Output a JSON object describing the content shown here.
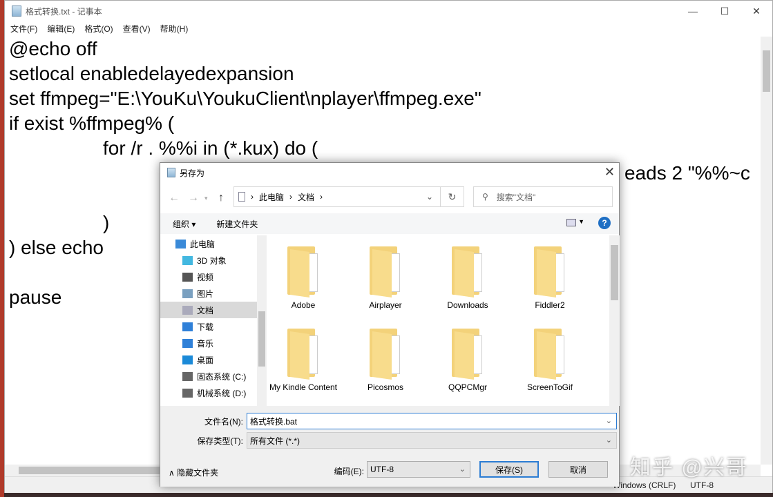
{
  "notepad": {
    "title": "格式转换.txt - 记事本",
    "window_buttons": [
      "—",
      "☐",
      "✕"
    ],
    "menu": [
      "文件(F)",
      "编辑(E)",
      "格式(O)",
      "查看(V)",
      "帮助(H)"
    ],
    "lines": [
      "@echo off",
      "setlocal enabledelayedexpansion",
      "set ffmpeg=\"E:\\YouKu\\YoukuClient\\nplayer\\ffmpeg.exe\"",
      "if exist %ffmpeg% (",
      "for /r . %%i in (*.kux) do (",
      "",
      "",
      ")",
      ") else echo",
      "",
      "pause"
    ],
    "partial_line": "eads 2 \"%%~c",
    "status": {
      "line_ending": "Windows (CRLF)",
      "encoding": "UTF-8"
    }
  },
  "watermark": "知乎 @兴哥",
  "dialog": {
    "title": "另存为",
    "close": "✕",
    "breadcrumb": [
      "此电脑",
      "文档"
    ],
    "search_placeholder": "搜索\"文档\"",
    "toolbar": {
      "organize": "组织 ▾",
      "new_folder": "新建文件夹",
      "help": "?"
    },
    "nav_items": [
      {
        "label": "此电脑",
        "icon": "computer-icon",
        "color": "#3a8ad8",
        "top": true
      },
      {
        "label": "3D 对象",
        "icon": "cube-icon",
        "color": "#43b8e0"
      },
      {
        "label": "视频",
        "icon": "film-icon",
        "color": "#555"
      },
      {
        "label": "图片",
        "icon": "picture-icon",
        "color": "#7aa0c0"
      },
      {
        "label": "文档",
        "icon": "document-icon",
        "color": "#aab",
        "selected": true
      },
      {
        "label": "下载",
        "icon": "download-icon",
        "color": "#2f80d8"
      },
      {
        "label": "音乐",
        "icon": "music-icon",
        "color": "#2f80d8"
      },
      {
        "label": "桌面",
        "icon": "desktop-icon",
        "color": "#1b8ad8"
      },
      {
        "label": "固态系统 (C:)",
        "icon": "drive-icon",
        "color": "#666"
      },
      {
        "label": "机械系统 (D:)",
        "icon": "drive-icon",
        "color": "#666"
      }
    ],
    "files": [
      "Adobe",
      "Airplayer",
      "Downloads",
      "Fiddler2",
      "My Kindle Content",
      "Picosmos",
      "QQPCMgr",
      "ScreenToGif"
    ],
    "filename_label": "文件名(N):",
    "filename": "格式转换.bat",
    "type_label": "保存类型(T):",
    "type": "所有文件 (*.*)",
    "hide_folders": "隐藏文件夹",
    "encoding_label": "编码(E):",
    "encoding": "UTF-8",
    "save": "保存(S)",
    "cancel": "取消"
  }
}
